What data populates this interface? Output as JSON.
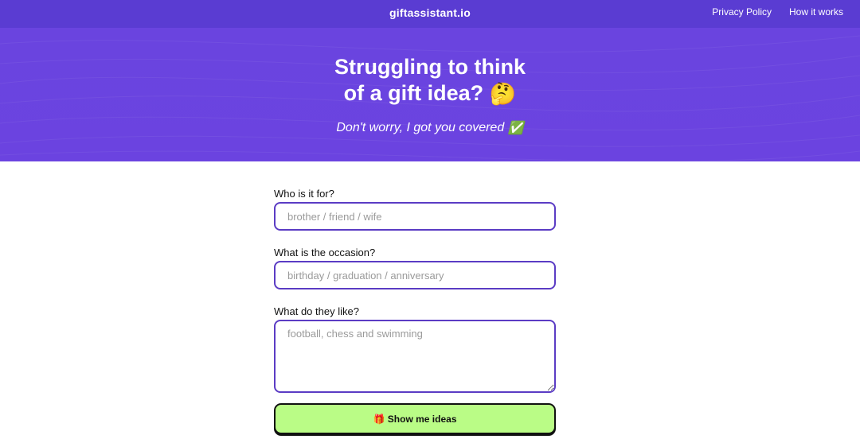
{
  "header": {
    "brand": "giftassistant.io",
    "nav": [
      {
        "label": "Privacy Policy"
      },
      {
        "label": "How it works"
      }
    ]
  },
  "hero": {
    "headline_line1": "Struggling to think",
    "headline_line2": "of a gift idea?",
    "headline_emoji": "🤔",
    "subtitle": "Don't worry, I got you covered",
    "subtitle_emoji": "✅"
  },
  "form": {
    "who": {
      "label": "Who is it for?",
      "placeholder": "brother / friend / wife",
      "value": ""
    },
    "occasion": {
      "label": "What is the occasion?",
      "placeholder": "birthday / graduation / anniversary",
      "value": ""
    },
    "likes": {
      "label": "What do they like?",
      "placeholder": "football, chess and swimming",
      "value": ""
    },
    "submit": {
      "icon": "🎁",
      "label": "Show me ideas"
    }
  },
  "colors": {
    "header_bg": "#5a3cd2",
    "hero_bg": "#6a44df",
    "field_border": "#5b3cc4",
    "button_bg": "#bafc86"
  }
}
